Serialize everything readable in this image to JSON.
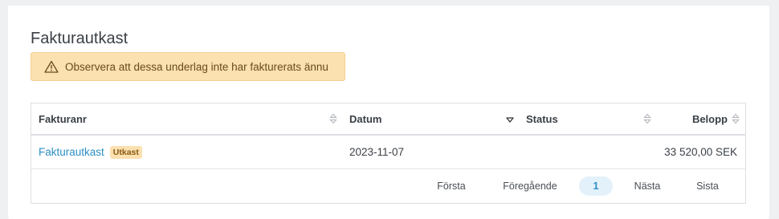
{
  "page": {
    "title": "Fakturautkast"
  },
  "alert": {
    "icon": "warning-triangle-icon",
    "text": "Observera att dessa underlag inte har fakturerats ännu"
  },
  "table": {
    "columns": [
      {
        "label": "Fakturanr",
        "sort": "none"
      },
      {
        "label": "Datum",
        "sort": "descending"
      },
      {
        "label": "Status",
        "sort": "none"
      },
      {
        "label": "Belopp",
        "sort": "none"
      }
    ],
    "rows": [
      {
        "invoice": "Fakturautkast",
        "badge": "Utkast",
        "date": "2023-11-07",
        "status": "",
        "amount": "33 520,00 SEK"
      }
    ]
  },
  "pagination": {
    "first": "Första",
    "previous": "Föregående",
    "current": "1",
    "next": "Nästa",
    "last": "Sista"
  },
  "colors": {
    "link": "#2d8ec4",
    "alert_bg": "#fbe0b0",
    "active_page_bg": "#e3f1fb"
  }
}
